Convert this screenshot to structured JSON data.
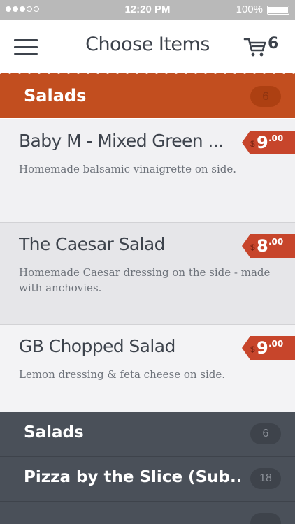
{
  "status_bar": {
    "time": "12:20 PM",
    "battery": "100%"
  },
  "nav": {
    "title": "Choose Items",
    "cart_count": "6",
    "menu_icon": "hamburger-icon",
    "cart_icon": "cart-icon"
  },
  "category": {
    "title": "Salads",
    "count": "6",
    "color": "#c24e1f"
  },
  "items": [
    {
      "name": "Baby M - Mixed Green ...",
      "description": "Homemade balsamic vinaigrette on side.",
      "currency": "$",
      "price_dollars": "9",
      "price_cents": ".00"
    },
    {
      "name": "The Caesar Salad",
      "description": "Homemade Caesar dressing on the side - made with anchovies.",
      "currency": "$",
      "price_dollars": "8",
      "price_cents": ".00"
    },
    {
      "name": "GB Chopped Salad",
      "description": "Lemon dressing & feta cheese on side.",
      "currency": "$",
      "price_dollars": "9",
      "price_cents": ".00"
    }
  ],
  "categories": [
    {
      "label": "Salads",
      "count": "6"
    },
    {
      "label": "Pizza by the Slice (Sub...",
      "count": "18"
    },
    {
      "label": "",
      "count": ""
    }
  ],
  "colors": {
    "accent": "#c24e1f",
    "price_tag": "#c7452b",
    "dark_panel": "#4a5059",
    "text_dark": "#3d434c"
  }
}
